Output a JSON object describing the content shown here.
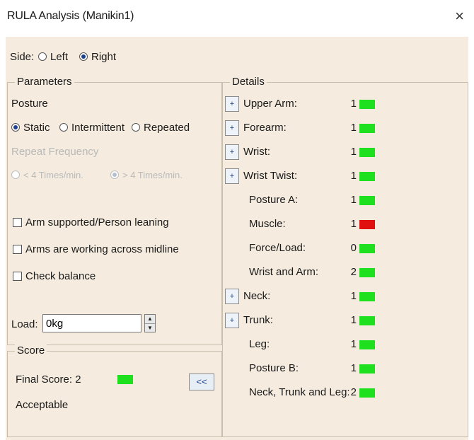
{
  "window": {
    "title": "RULA Analysis (Manikin1)",
    "close_glyph": "×"
  },
  "side": {
    "label": "Side:",
    "options": [
      "Left",
      "Right"
    ],
    "selected": "Right"
  },
  "parameters": {
    "legend": "Parameters",
    "posture_label": "Posture",
    "posture_options": [
      "Static",
      "Intermittent",
      "Repeated"
    ],
    "posture_selected": "Static",
    "repeat_label": "Repeat Frequency",
    "repeat_options": [
      "< 4 Times/min.",
      "> 4 Times/min."
    ],
    "repeat_selected": "> 4 Times/min.",
    "checkboxes": [
      "Arm supported/Person leaning",
      "Arms are working across midline",
      "Check balance"
    ],
    "load_label": "Load:",
    "load_value": "0kg"
  },
  "score": {
    "legend": "Score",
    "final_label": "Final Score: 2",
    "final_color": "#1fe01f",
    "verdict": "Acceptable",
    "collapse_label": "<<"
  },
  "details": {
    "legend": "Details",
    "expand_glyph": "+",
    "rows": [
      {
        "label": "Upper Arm:",
        "value": "1",
        "color": "#1fe01f",
        "expandable": true
      },
      {
        "label": "Forearm:",
        "value": "1",
        "color": "#1fe01f",
        "expandable": true
      },
      {
        "label": "Wrist:",
        "value": "1",
        "color": "#1fe01f",
        "expandable": true
      },
      {
        "label": "Wrist Twist:",
        "value": "1",
        "color": "#1fe01f",
        "expandable": true
      },
      {
        "label": "Posture A:",
        "value": "1",
        "color": "#1fe01f",
        "expandable": false
      },
      {
        "label": "Muscle:",
        "value": "1",
        "color": "#e01010",
        "expandable": false
      },
      {
        "label": "Force/Load:",
        "value": "0",
        "color": "#1fe01f",
        "expandable": false
      },
      {
        "label": "Wrist and Arm:",
        "value": "2",
        "color": "#1fe01f",
        "expandable": false
      },
      {
        "label": "Neck:",
        "value": "1",
        "color": "#1fe01f",
        "expandable": true
      },
      {
        "label": "Trunk:",
        "value": "1",
        "color": "#1fe01f",
        "expandable": true
      },
      {
        "label": "Leg:",
        "value": "1",
        "color": "#1fe01f",
        "expandable": false
      },
      {
        "label": "Posture B:",
        "value": "1",
        "color": "#1fe01f",
        "expandable": false
      },
      {
        "label": "Neck, Trunk and Leg:",
        "value": "2",
        "color": "#1fe01f",
        "expandable": false
      }
    ]
  }
}
